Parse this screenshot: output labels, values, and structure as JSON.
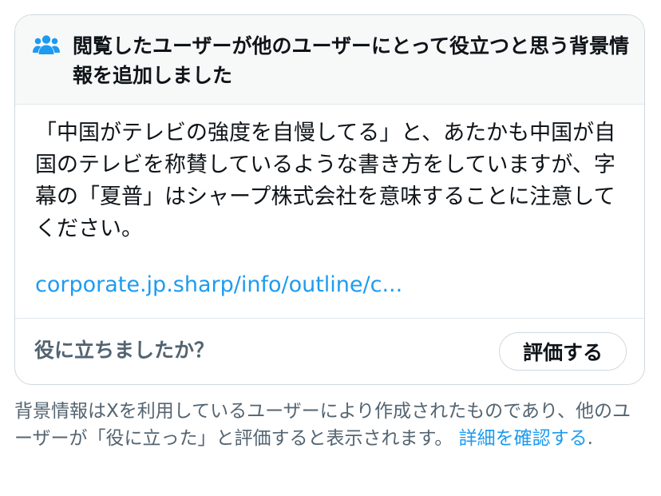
{
  "note": {
    "header": {
      "icon": "people-group-icon",
      "title": "閲覧したユーザーが他のユーザーにとって役立つと思う背景情報を追加しました"
    },
    "body": "「中国がテレビの強度を自慢してる」と、あたかも中国が自国のテレビを称賛しているような書き方をしていますが、字幕の「夏普」はシャープ株式会社を意味することに注意してください。",
    "link_text": "corporate.jp.sharp/info/outline/c...",
    "footer": {
      "question": "役に立ちましたか？",
      "rate_button": "評価する"
    }
  },
  "disclaimer": {
    "text": "背景情報はXを利用しているユーザーにより作成されたものであり、他のユーザーが「役に立った」と評価すると表示されます。",
    "learn_more": "詳細を確認する",
    "suffix": "."
  },
  "colors": {
    "accent": "#1d9bf0",
    "text_primary": "#0f1419",
    "text_secondary": "#536471",
    "border": "#cfd9de",
    "header_bg": "#f7f9f9"
  }
}
